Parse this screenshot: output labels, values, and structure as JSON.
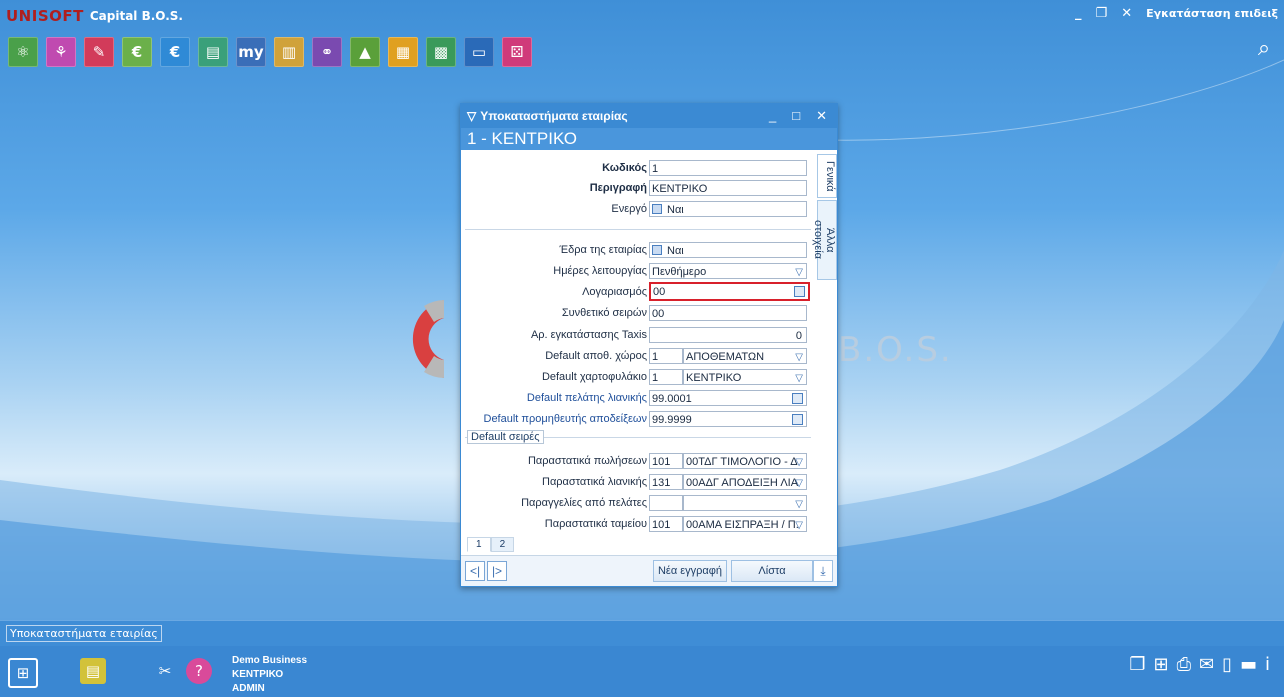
{
  "app": {
    "brand": "UNISOFT",
    "title": "Capital B.O.S.",
    "install_label": "Εγκατάσταση επιδειξ",
    "watermark": "B.O.S."
  },
  "appbar": [
    {
      "name": "module-1-icon",
      "glyph": "⚛",
      "color": "#4aa04a"
    },
    {
      "name": "module-2-icon",
      "glyph": "⚘",
      "color": "#c04ab0"
    },
    {
      "name": "module-3-icon",
      "glyph": "✎",
      "color": "#d23b5a"
    },
    {
      "name": "module-4-icon",
      "glyph": "€",
      "color": "#6bb04a"
    },
    {
      "name": "module-5-icon",
      "glyph": "€",
      "color": "#2f8ad6"
    },
    {
      "name": "module-6-icon",
      "glyph": "▤",
      "color": "#3aa07a"
    },
    {
      "name": "module-7-icon",
      "glyph": "my",
      "color": "#3a6eb8"
    },
    {
      "name": "module-8-icon",
      "glyph": "▥",
      "color": "#d0a23a"
    },
    {
      "name": "module-9-icon",
      "glyph": "⚭",
      "color": "#7a4ab0"
    },
    {
      "name": "module-10-icon",
      "glyph": "▲",
      "color": "#5aa03a"
    },
    {
      "name": "module-11-icon",
      "glyph": "▦",
      "color": "#e0a020"
    },
    {
      "name": "module-12-icon",
      "glyph": "▩",
      "color": "#3a9a5a"
    },
    {
      "name": "module-13-icon",
      "glyph": "▭",
      "color": "#2a6ab8"
    },
    {
      "name": "module-14-icon",
      "glyph": "⚄",
      "color": "#d03a7a"
    }
  ],
  "dialog": {
    "title": "Υποκαταστήματα εταιρίας",
    "header": "1 - ΚΕΝΤΡΙΚΟ",
    "side_tabs": [
      "Γενικά",
      "Άλλα στοιχεία"
    ],
    "fields": {
      "code_label": "Κωδικός",
      "code_value": "1",
      "desc_label": "Περιγραφή",
      "desc_value": "ΚΕΝΤΡΙΚΟ",
      "active_label": "Ενεργό",
      "active_value": "Ναι",
      "seat_label": "Έδρα της εταιρίας",
      "seat_value": "Ναι",
      "workdays_label": "Ημέρες λειτουργίας",
      "workdays_value": "Πενθήμερο",
      "account_label": "Λογαριασμός",
      "account_value": "00",
      "series_comp_label": "Συνθετικό σειρών",
      "series_comp_value": "00",
      "taxis_label": "Αρ. εγκατάστασης Taxis",
      "taxis_value": "0",
      "warehouse_label": "Default αποθ. χώρος",
      "warehouse_code": "1",
      "warehouse_name": "ΑΠΟΘΕΜΑΤΩΝ",
      "portfolio_label": "Default χαρτοφυλάκιο",
      "portfolio_code": "1",
      "portfolio_name": "ΚΕΝΤΡΙΚΟ",
      "retail_customer_label": "Default πελάτης λιανικής",
      "retail_customer_value": "99.0001",
      "receipt_supplier_label": "Default προμηθευτής αποδείξεων",
      "receipt_supplier_value": "99.9999",
      "default_series_group": "Default σειρές",
      "sales_docs_label": "Παραστατικά πωλήσεων",
      "sales_docs_code": "101",
      "sales_docs_name": "00ΤΔΓ ΤΙΜΟΛΟΓΙΟ - Δ",
      "retail_docs_label": "Παραστατικά λιανικής",
      "retail_docs_code": "131",
      "retail_docs_name": "00ΑΔΓ ΑΠΟΔΕΙΞΗ ΛΙΑ",
      "orders_label": "Παραγγελίες από πελάτες",
      "orders_code": "",
      "orders_name": "",
      "cash_docs_label": "Παραστατικά ταμείου",
      "cash_docs_code": "101",
      "cash_docs_name": "00ΑΜΑ ΕΙΣΠΡΑΞΗ / Π."
    },
    "pages": [
      "1",
      "2"
    ],
    "new_record": "Νέα εγγραφή",
    "list": "Λίστα"
  },
  "status": {
    "open_tab": "Υποκαταστήματα εταιρίας"
  },
  "company": {
    "name": "Demo Business",
    "branch": "ΚΕΝΤΡΙΚΟ",
    "user": "ADMIN"
  }
}
